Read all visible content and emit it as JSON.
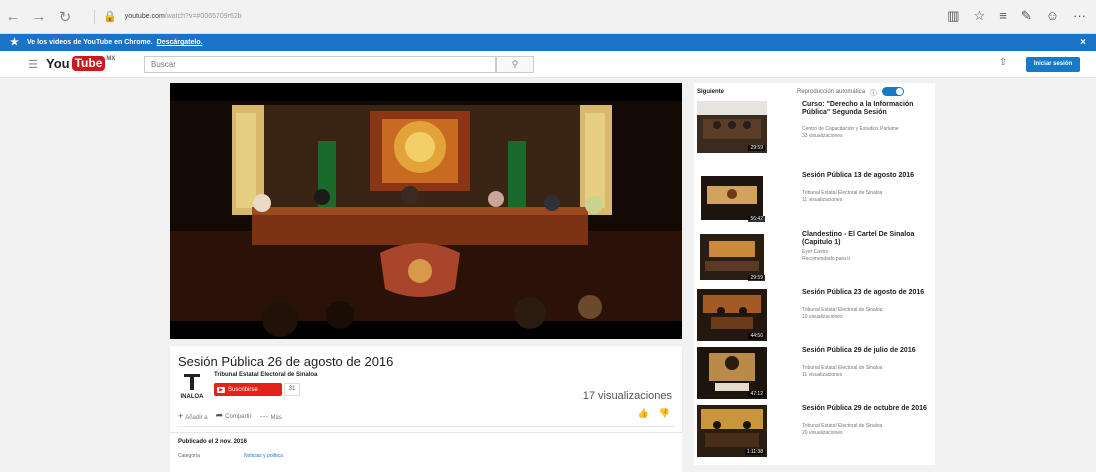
{
  "browser": {
    "back_icon": "←",
    "forward_icon": "→",
    "refresh_icon": "↻",
    "lock_icon": "lock-icon",
    "url_domain": "youtube.com",
    "url_path": "/watch?v=#0065709r62b",
    "favorite_icon": "☆",
    "menu_icon": "≡",
    "notes_icon": "✎",
    "share_icon": "☺",
    "more_icon": "···"
  },
  "banner": {
    "text": "Ve los videos de YouTube en Chrome.",
    "link": "Descárgatelo.",
    "close": "×"
  },
  "header": {
    "logo_you": "You",
    "logo_tube": "Tube",
    "logo_mx": "MX",
    "search_placeholder": "Buscar",
    "search_icon": "🔍",
    "upload_icon": "⇧",
    "signin": "Iniciar sesión"
  },
  "video": {
    "title": "Sesión Pública 26 de agosto de 2016",
    "channel": "Tribunal Estatal Electoral de Sinaloa",
    "subscribe": "Suscribirse",
    "subscribers": "31",
    "views": "17 visualizaciones",
    "add_to": "Añadir a",
    "share": "Compartir",
    "more": "Más",
    "published": "Publicado el 2 nov. 2016",
    "category_label": "Categoría",
    "category_value": "Noticias y política",
    "logo_text": "INALOA"
  },
  "sidebar": {
    "heading": "Siguiente",
    "autoplay": "Reproducción automática",
    "items": [
      {
        "title": "Curso: \"Derecho a la Información Pública\" Segunda Sesión",
        "channel": "Centro de Capacitación y Estudios Parlame",
        "meta": "33 visualizaciones",
        "duration": "29:59"
      },
      {
        "title": "Sesión Pública 13 de agosto 2016",
        "channel": "Tribunal Estatal Electoral de Sinaloa",
        "meta": "11 visualizaciones",
        "duration": "56:42"
      },
      {
        "title": "Clandestino - El Cartel De Sinaloa (Capitulo 1)",
        "channel": "Eyer Castro",
        "meta": "Recomendado para ti",
        "duration": "29:59"
      },
      {
        "title": "Sesión Pública 23 de agosto de 2016",
        "channel": "Tribunal Estatal Electoral de Sinaloa",
        "meta": "10 visualizaciones",
        "duration": "44:50"
      },
      {
        "title": "Sesión Pública 29 de julio de 2016",
        "channel": "Tribunal Estatal Electoral de Sinaloa",
        "meta": "11 visualizaciones",
        "duration": "47:12"
      },
      {
        "title": "Sesión Pública 29 de octubre de 2016",
        "channel": "Tribunal Estatal Electoral de Sinaloa",
        "meta": "20 visualizaciones",
        "duration": "1:11:38"
      }
    ]
  }
}
